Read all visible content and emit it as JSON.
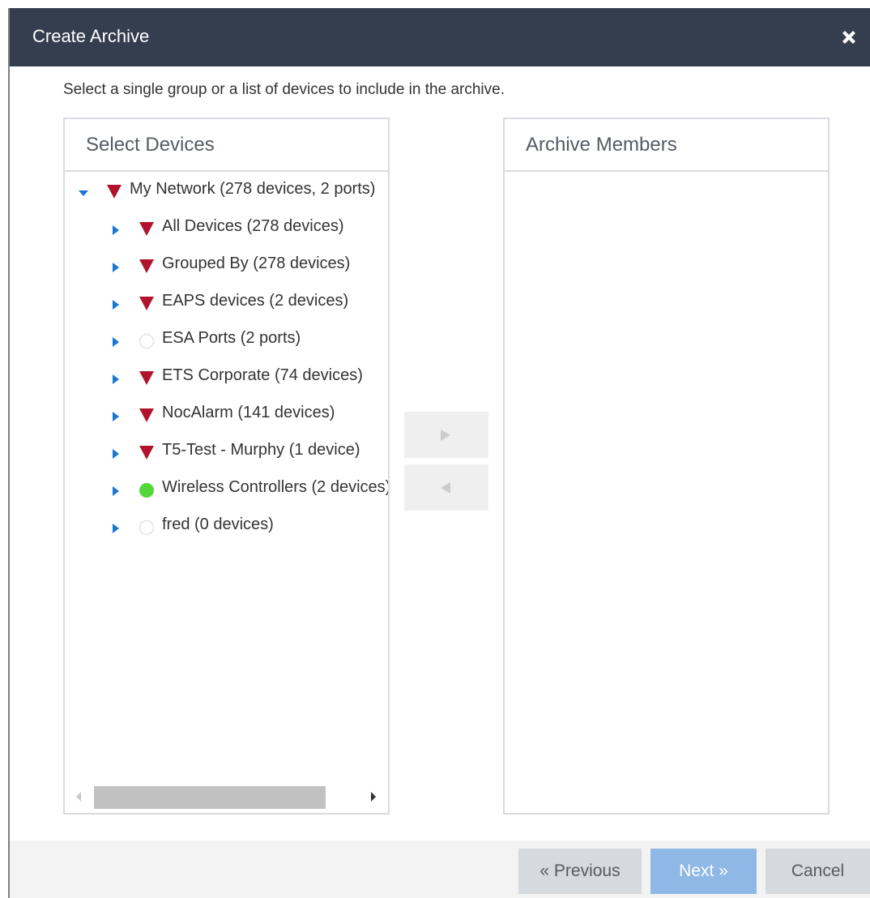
{
  "dialog": {
    "title": "Create Archive",
    "instruction": "Select a single group or a list of devices to include in the archive."
  },
  "select_panel": {
    "header": "Select Devices",
    "tree": [
      {
        "label": "My Network (278 devices, 2 ports)",
        "status": "red-triangle",
        "expanded": true,
        "level": 0
      },
      {
        "label": "All Devices (278 devices)",
        "status": "red-triangle",
        "expanded": false,
        "level": 1
      },
      {
        "label": "Grouped By (278 devices)",
        "status": "red-triangle",
        "expanded": false,
        "level": 1
      },
      {
        "label": "EAPS devices (2 devices)",
        "status": "red-triangle",
        "expanded": false,
        "level": 1
      },
      {
        "label": "ESA Ports (2 ports)",
        "status": "empty-circle",
        "expanded": false,
        "level": 1
      },
      {
        "label": "ETS Corporate (74 devices)",
        "status": "red-triangle",
        "expanded": false,
        "level": 1
      },
      {
        "label": "NocAlarm (141 devices)",
        "status": "red-triangle",
        "expanded": false,
        "level": 1
      },
      {
        "label": "T5-Test - Murphy (1 device)",
        "status": "red-triangle",
        "expanded": false,
        "level": 1
      },
      {
        "label": "Wireless Controllers (2 devices)",
        "status": "green-circle",
        "expanded": false,
        "level": 1
      },
      {
        "label": "fred (0 devices)",
        "status": "empty-circle",
        "expanded": false,
        "level": 1
      }
    ]
  },
  "members_panel": {
    "header": "Archive Members"
  },
  "buttons": {
    "previous": "« Previous",
    "next": "Next »",
    "cancel": "Cancel"
  },
  "colors": {
    "title_bar": "#343e4e",
    "alarm_red": "#b0142c",
    "ok_green": "#52d63a",
    "caret_blue": "#1976d2",
    "next_button": "#8fb8e6"
  }
}
